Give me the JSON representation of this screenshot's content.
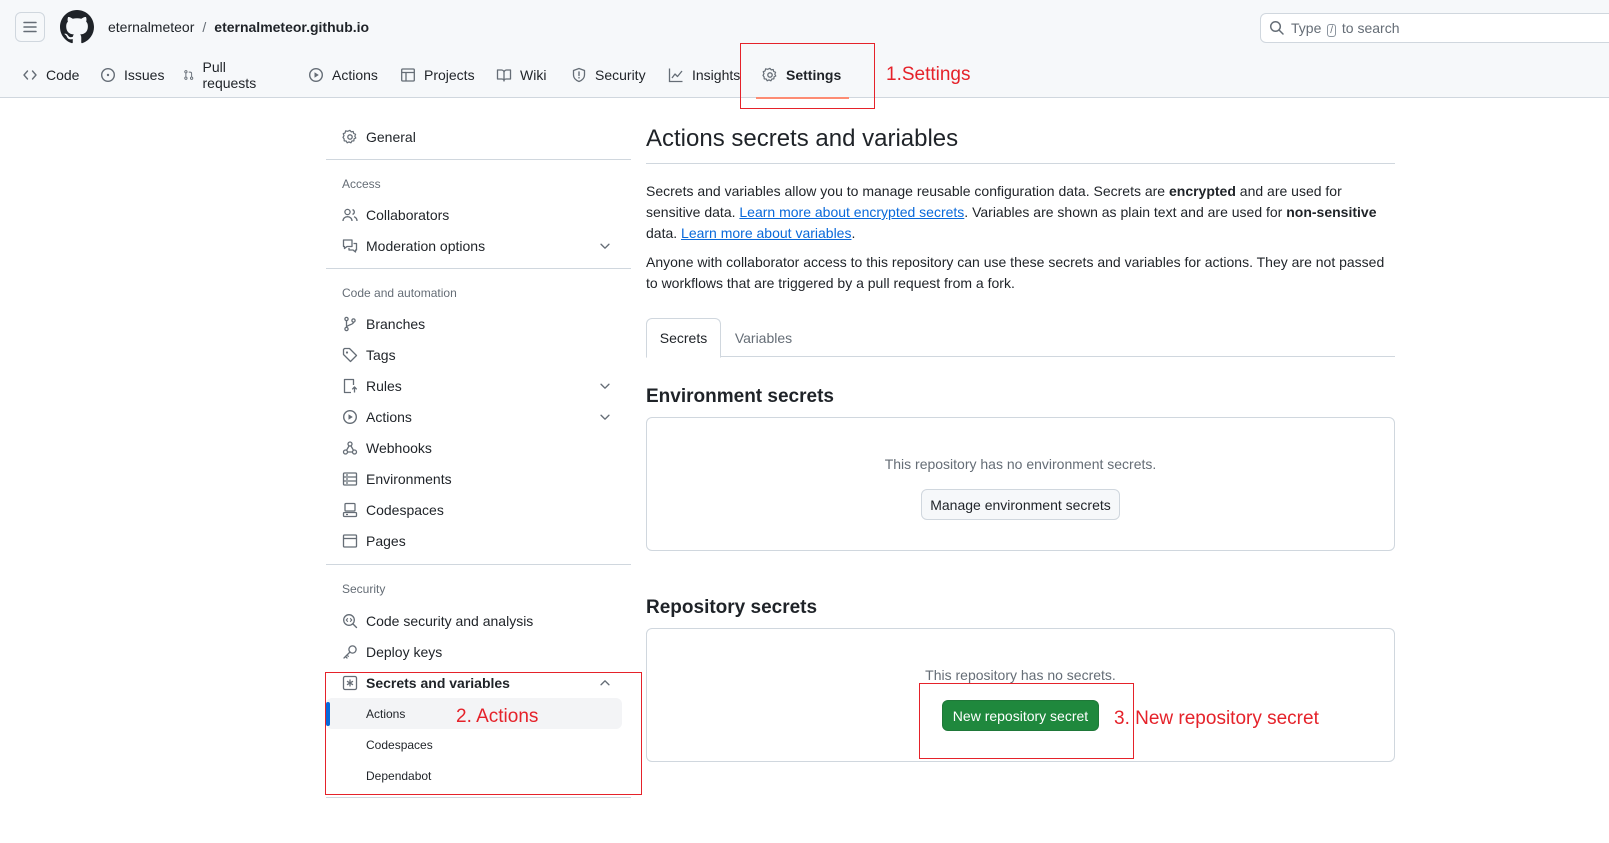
{
  "header": {
    "owner": "eternalmeteor",
    "separator": "/",
    "repo": "eternalmeteor.github.io",
    "search_prefix": "Type",
    "search_key": "/",
    "search_suffix": "to search"
  },
  "nav": {
    "code": "Code",
    "issues": "Issues",
    "pull_requests": "Pull requests",
    "actions": "Actions",
    "projects": "Projects",
    "wiki": "Wiki",
    "security": "Security",
    "insights": "Insights",
    "settings": "Settings"
  },
  "annotations": {
    "step1": "1.Settings",
    "step2": "2. Actions",
    "step3": "3. New repository secret",
    "color": "#e5222a"
  },
  "sidebar": {
    "general": "General",
    "access_heading": "Access",
    "collaborators": "Collaborators",
    "moderation": "Moderation options",
    "code_heading": "Code and automation",
    "branches": "Branches",
    "tags": "Tags",
    "rules": "Rules",
    "actions": "Actions",
    "webhooks": "Webhooks",
    "environments": "Environments",
    "codespaces": "Codespaces",
    "pages": "Pages",
    "security_heading": "Security",
    "code_security": "Code security and analysis",
    "deploy_keys": "Deploy keys",
    "secrets_vars": "Secrets and variables",
    "sub_actions": "Actions",
    "sub_codespaces": "Codespaces",
    "sub_dependabot": "Dependabot"
  },
  "main": {
    "title": "Actions secrets and variables",
    "desc1_a": "Secrets and variables allow you to manage reusable configuration data. Secrets are ",
    "desc1_b": "encrypted",
    "desc1_c": " and are used for sensitive data. ",
    "desc1_link1": "Learn more about encrypted secrets",
    "desc1_d": ". Variables are shown as plain text and are used for ",
    "desc1_e": "non-sensitive",
    "desc1_f": " data. ",
    "desc1_link2": "Learn more about variables",
    "desc1_g": ".",
    "desc2": "Anyone with collaborator access to this repository can use these secrets and variables for actions. They are not passed to workflows that are triggered by a pull request from a fork.",
    "tab_secrets": "Secrets",
    "tab_variables": "Variables",
    "env_title": "Environment secrets",
    "env_empty": "This repository has no environment secrets.",
    "env_button": "Manage environment secrets",
    "repo_title": "Repository secrets",
    "repo_empty": "This repository has no secrets.",
    "repo_button": "New repository secret"
  },
  "colors": {
    "primary_button": "#1f883d",
    "link": "#0969da",
    "active_tab_underline": "#fd8c73"
  }
}
